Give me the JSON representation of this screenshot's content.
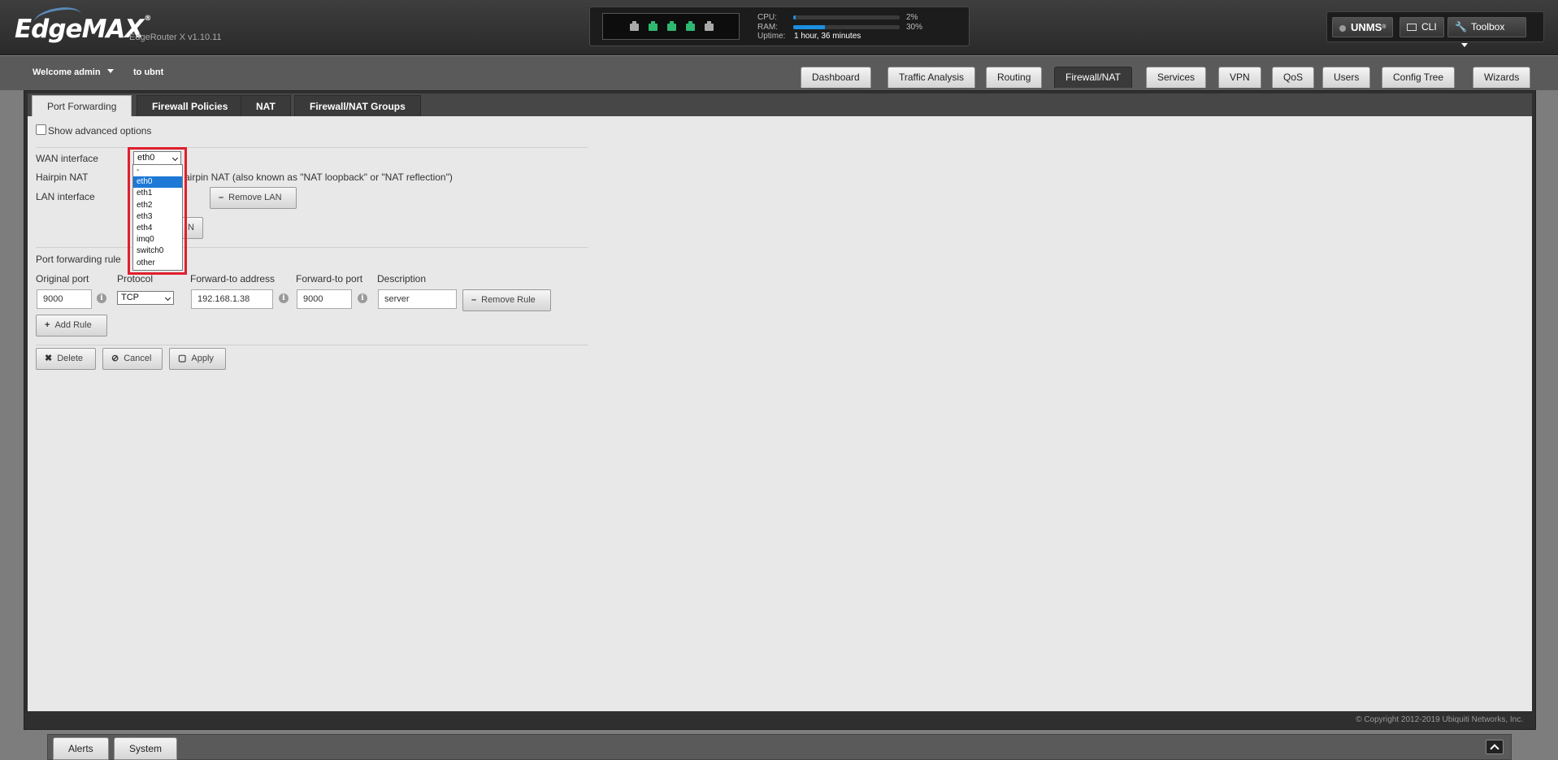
{
  "header": {
    "logo": "EdgeMAX",
    "logo_mark": "®",
    "device": "EdgeRouter X v1.10.11",
    "stats": {
      "cpu_label": "CPU:",
      "cpu_value": "2%",
      "cpu_fraction": 0.02,
      "ram_label": "RAM:",
      "ram_value": "30%",
      "ram_fraction": 0.3,
      "uptime_label": "Uptime:",
      "uptime_value": "1 hour, 36 minutes"
    },
    "ports": [
      "inactive",
      "active",
      "active",
      "active",
      "inactive"
    ],
    "port_colors": {
      "active": "#2eb872",
      "inactive": "#a9a9a9"
    },
    "tools": {
      "unms": "UNMS",
      "unms_mark": "®",
      "cli": "CLI",
      "toolbox": "Toolbox"
    }
  },
  "userbar": {
    "welcome": "Welcome admin",
    "to_ubnt": "to ubnt"
  },
  "main_tabs": [
    "Dashboard",
    "Traffic Analysis",
    "Routing",
    "Firewall/NAT",
    "Services",
    "VPN",
    "QoS",
    "Users",
    "Config Tree",
    "Wizards"
  ],
  "main_tab_active": "Firewall/NAT",
  "sub_tabs": [
    "Port Forwarding",
    "Firewall Policies",
    "NAT",
    "Firewall/NAT Groups"
  ],
  "sub_tab_active": "Port Forwarding",
  "form": {
    "show_advanced": "Show advanced options",
    "wan_label": "WAN interface",
    "wan_value": "eth0",
    "hairpin_label": "Hairpin NAT",
    "hairpin_text": "airpin NAT (also known as \"NAT loopback\" or \"NAT reflection\")",
    "lan_label": "LAN interface",
    "remove_lan": "Remove LAN",
    "add_lan_partial": "N",
    "rules_label": "Port forwarding rule",
    "col_original_port": "Original port",
    "col_protocol": "Protocol",
    "col_forward_address": "Forward-to address",
    "col_forward_port": "Forward-to port",
    "col_description": "Description",
    "rule": {
      "original_port": "9000",
      "protocol": "TCP",
      "forward_address": "192.168.1.38",
      "forward_port": "9000",
      "description": "server"
    },
    "remove_rule": "Remove Rule",
    "add_rule": "Add Rule",
    "delete": "Delete",
    "cancel": "Cancel",
    "apply": "Apply"
  },
  "wan_dropdown": {
    "options": [
      "-",
      "eth0",
      "eth1",
      "eth2",
      "eth3",
      "eth4",
      "imq0",
      "switch0",
      "other"
    ],
    "selected": "eth0"
  },
  "copyright": "© Copyright 2012-2019 Ubiquiti Networks, Inc.",
  "footer": {
    "alerts": "Alerts",
    "system": "System"
  }
}
